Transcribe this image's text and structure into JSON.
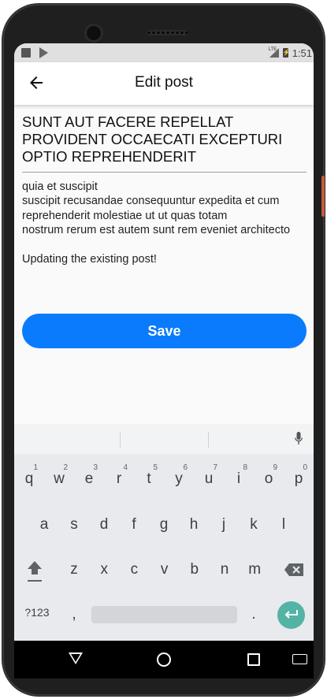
{
  "status_bar": {
    "network": "LTE",
    "time": "1:51"
  },
  "app_bar": {
    "title": "Edit post"
  },
  "post": {
    "title": "SUNT AUT FACERE REPELLAT PROVIDENT OCCAECATI EXCEPTURI OPTIO REPREHENDERIT",
    "body": "quia et suscipit\nsuscipit recusandae consequuntur expedita et cum reprehenderit molestiae ut ut quas totam\nnostrum rerum est autem sunt rem eveniet architecto\n\nUpdating the existing post!"
  },
  "actions": {
    "save_label": "Save"
  },
  "keyboard": {
    "row1": [
      "q",
      "w",
      "e",
      "r",
      "t",
      "y",
      "u",
      "i",
      "o",
      "p"
    ],
    "row1_hints": [
      "1",
      "2",
      "3",
      "4",
      "5",
      "6",
      "7",
      "8",
      "9",
      "0"
    ],
    "row2": [
      "a",
      "s",
      "d",
      "f",
      "g",
      "h",
      "j",
      "k",
      "l"
    ],
    "row3": [
      "z",
      "x",
      "c",
      "v",
      "b",
      "n",
      "m"
    ],
    "symbols_label": "?123",
    "comma": ",",
    "period": "."
  },
  "colors": {
    "accent": "#0a7bfd",
    "enter": "#53b3a4"
  }
}
